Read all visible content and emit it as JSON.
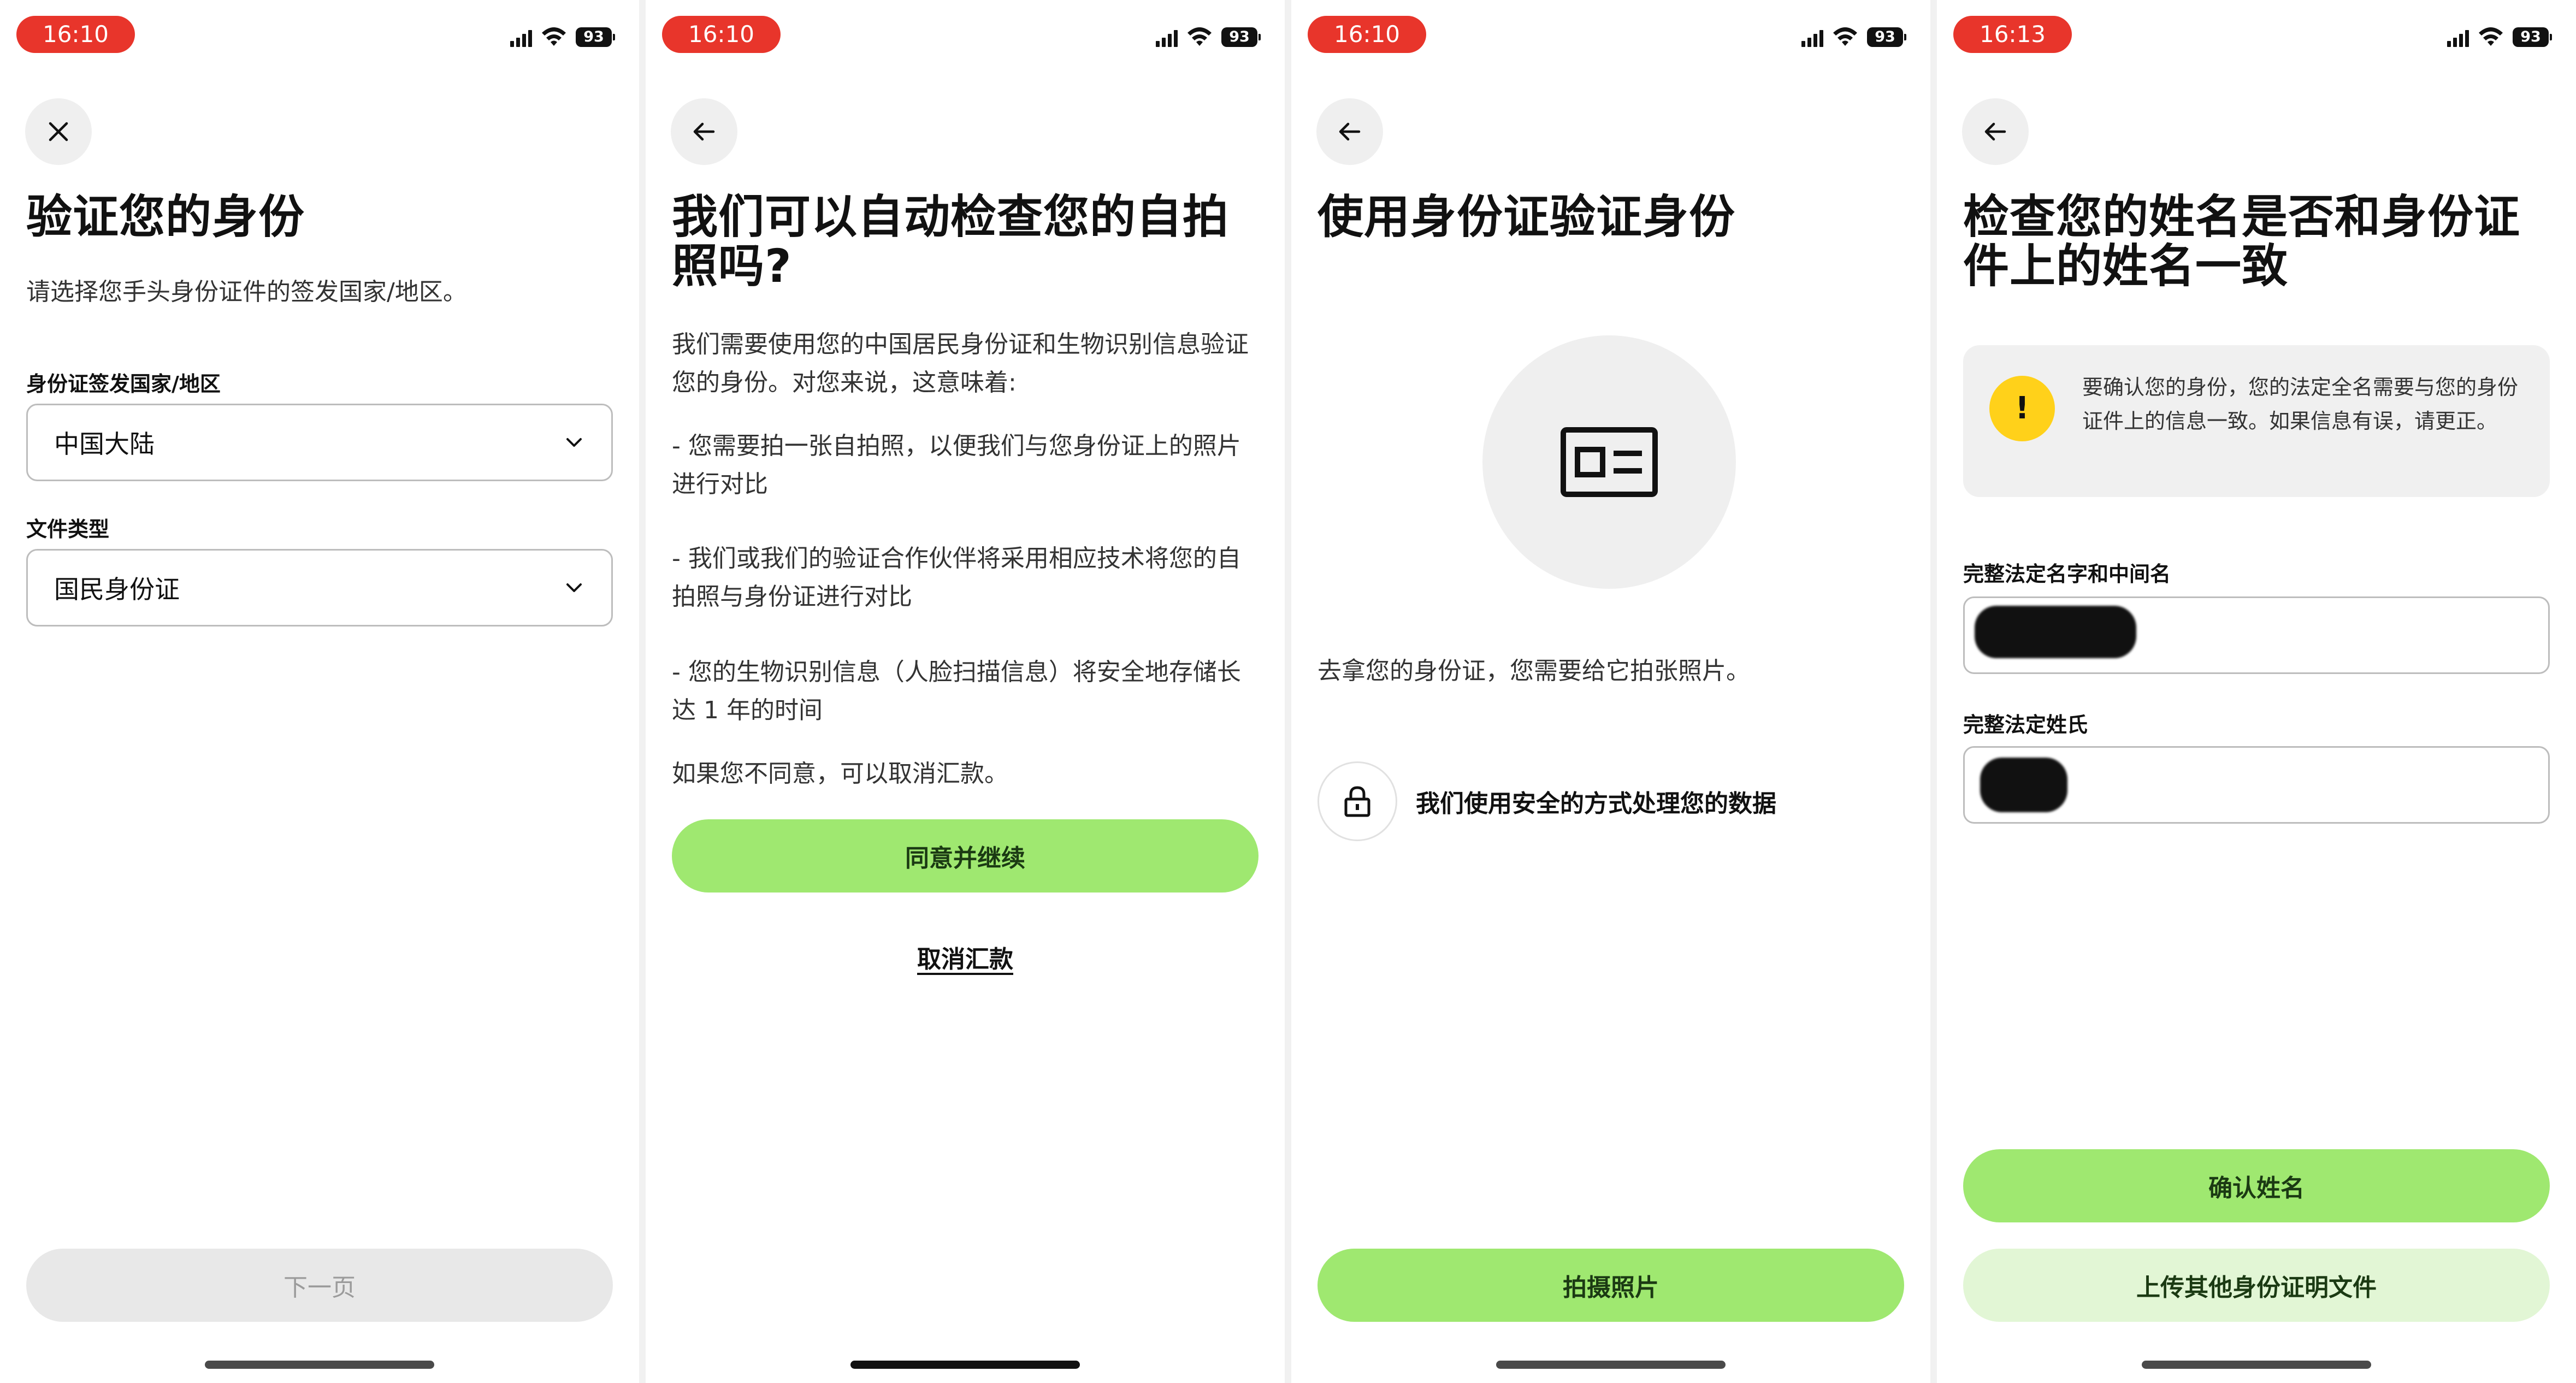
{
  "status": {
    "battery": "93"
  },
  "screens": [
    {
      "time": "16:10",
      "nav": "close-icon",
      "title": "验证您的身份",
      "subtitle": "请选择您手头身份证件的签发国家/地区。",
      "country_label": "身份证签发国家/地区",
      "country_value": "中国大陆",
      "doc_label": "文件类型",
      "doc_value": "国民身份证",
      "next_button": "下一页"
    },
    {
      "time": "16:10",
      "nav": "arrow-left-icon",
      "title": "我们可以自动检查您的自拍照吗?",
      "intro": "我们需要使用您的中国居民身份证和生物识别信息验证您的身份。对您来说，这意味着:",
      "point1": "- 您需要拍一张自拍照，以便我们与您身份证上的照片进行对比",
      "point2": "- 我们或我们的验证合作伙伴将采用相应技术将您的自拍照与身份证进行对比",
      "point3": "- 您的生物识别信息（人脸扫描信息）将安全地存储长达 1 年的时间",
      "disagree": "如果您不同意，可以取消汇款。",
      "agree_button": "同意并继续",
      "cancel_link": "取消汇款"
    },
    {
      "time": "16:10",
      "nav": "arrow-left-icon",
      "title": "使用身份证验证身份",
      "instruction": "去拿您的身份证，您需要给它拍张照片。",
      "secure_text": "我们使用安全的方式处理您的数据",
      "photo_button": "拍摄照片"
    },
    {
      "time": "16:13",
      "nav": "arrow-left-icon",
      "title": "检查您的姓名是否和身份证件上的姓名一致",
      "notice": "要确认您的身份，您的法定全名需要与您的身份证件上的信息一致。如果信息有误，请更正。",
      "given_label": "完整法定名字和中间名",
      "family_label": "完整法定姓氏",
      "confirm_button": "确认姓名",
      "upload_button": "上传其他身份证明文件"
    }
  ]
}
